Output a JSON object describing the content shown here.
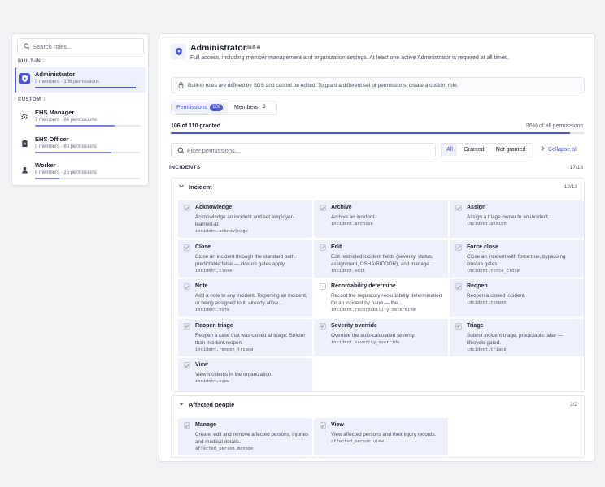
{
  "sidebar": {
    "search_placeholder": "Search roles...",
    "builtin_label": "BUILT-IN",
    "builtin_count": "1",
    "custom_label": "CUSTOM",
    "custom_count": "3",
    "roles": [
      {
        "name": "Administrator",
        "meta": "3 members · 106 permissions",
        "progress": 0.964,
        "icon": "shield-icon",
        "active": true
      },
      {
        "name": "EHS Manager",
        "meta": "7 members · 84 permissions",
        "progress": 0.76,
        "icon": "gear-icon",
        "active": false
      },
      {
        "name": "EHS Officer",
        "meta": "3 members · 80 permissions",
        "progress": 0.73,
        "icon": "clipboard-icon",
        "active": false
      },
      {
        "name": "Worker",
        "meta": "8 members · 25 permissions",
        "progress": 0.23,
        "icon": "person-icon",
        "active": false
      }
    ]
  },
  "header": {
    "title": "Administrator",
    "badge": "Built-in",
    "description": "Full access, including member management and organization settings. At least one active Administrator is required at all times."
  },
  "notice": "Built-in roles are defined by SDS and cannot be edited. To grant a different set of permissions, create a custom role.",
  "tabs": [
    {
      "label": "Permissions",
      "count": "106"
    },
    {
      "label": "Members",
      "count": "3"
    }
  ],
  "summary": {
    "granted_text": "106 of 110 granted",
    "percent_text": "96% of all permissions",
    "progress": 0.964
  },
  "filter": {
    "placeholder": "Filter permissions...",
    "options": [
      "All",
      "Granted",
      "Not granted"
    ],
    "collapse_label": "Collapse all"
  },
  "section": {
    "label": "INCIDENTS",
    "count": "17/18"
  },
  "groups": [
    {
      "name": "Incident",
      "count": "12/13",
      "permissions": [
        {
          "name": "Acknowledge",
          "desc": "Acknowledge an incident and set employer-learned-at.",
          "key": "incident.acknowledge",
          "granted": true
        },
        {
          "name": "Archive",
          "desc": "Archive an incident.",
          "key": "incident.archive",
          "granted": true
        },
        {
          "name": "Assign",
          "desc": "Assign a triage owner to an incident.",
          "key": "incident.assign",
          "granted": true
        },
        {
          "name": "Close",
          "desc": "Close an incident through the standard path. predictable:false — closure gates apply.",
          "key": "incident.close",
          "granted": true
        },
        {
          "name": "Edit",
          "desc": "Edit restricted incident fields (severity, status, assignment, OSHA/RIDDOR), and manage…",
          "key": "incident.edit",
          "granted": true
        },
        {
          "name": "Force close",
          "desc": "Close an incident with force:true, bypassing closure gates.",
          "key": "incident.force_close",
          "granted": true
        },
        {
          "name": "Note",
          "desc": "Add a note to any incident. Reporting an incident, or being assigned to it, already allow…",
          "key": "incident.note",
          "granted": true
        },
        {
          "name": "Recordability determine",
          "desc": "Record the regulatory recordability determination for an incident by hand — the…",
          "key": "incident.recordability_determine",
          "granted": false
        },
        {
          "name": "Reopen",
          "desc": "Reopen a closed incident.",
          "key": "incident.reopen",
          "granted": true
        },
        {
          "name": "Reopen triage",
          "desc": "Reopen a case that was closed at triage. Stricter than incident.reopen.",
          "key": "incident.reopen_triage",
          "granted": true
        },
        {
          "name": "Severity override",
          "desc": "Override the auto-calculated severity.",
          "key": "incident.severity_override",
          "granted": true
        },
        {
          "name": "Triage",
          "desc": "Submit incident triage. predictable:false — lifecycle-gated.",
          "key": "incident.triage",
          "granted": true
        },
        {
          "name": "View",
          "desc": "View incidents in the organization.",
          "key": "incident.view",
          "granted": true
        }
      ]
    },
    {
      "name": "Affected people",
      "count": "2/2",
      "permissions": [
        {
          "name": "Manage",
          "desc": "Create, edit and remove affected persons, injuries and medical details.",
          "key": "affected_person.manage",
          "granted": true
        },
        {
          "name": "View",
          "desc": "View affected persons and their injury records.",
          "key": "affected_person.view",
          "granted": true
        }
      ]
    }
  ]
}
